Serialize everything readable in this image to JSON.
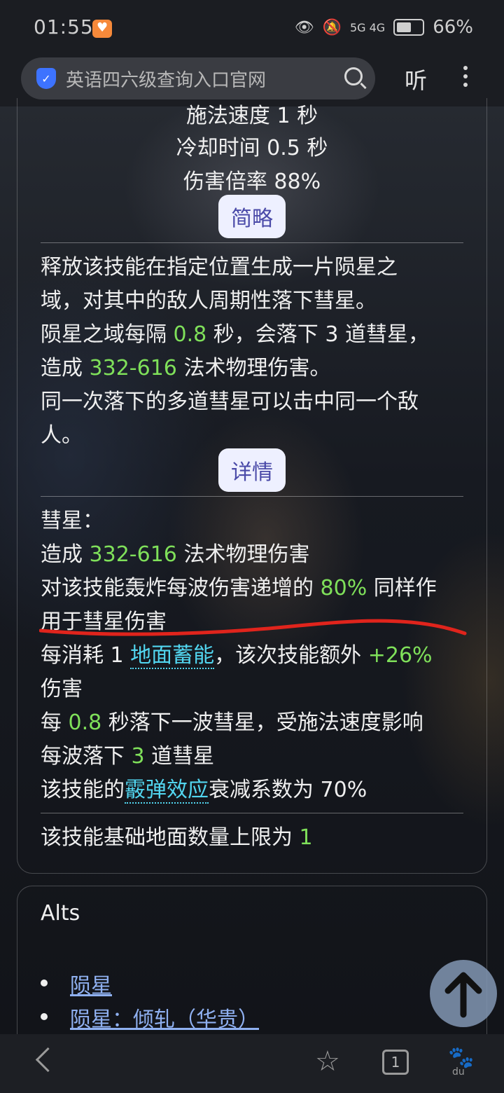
{
  "status_bar": {
    "time": "01:55",
    "network": "5G 4G",
    "battery": "66%"
  },
  "address_bar": {
    "query": "英语四六级查询入口官网",
    "listen_label": "听"
  },
  "skill": {
    "stats": [
      "施法速度 1 秒",
      "冷却时间  0.5 秒",
      "伤害倍率  88%"
    ],
    "summary_tab": "简略",
    "summary": {
      "line1": "释放该技能在指定位置生成一片陨星之",
      "line2": "域，对其中的敌人周期性落下彗星。",
      "line3_a": "陨星之域每隔 ",
      "line3_g": "0.8",
      "line3_b": " 秒，会落下 3 道彗星，",
      "line4_a": "造成 ",
      "line4_g": "332-616",
      "line4_b": " 法术物理伤害。",
      "line5": "同一次落下的多道彗星可以击中同一个敌",
      "line6": "人。"
    },
    "detail_tab": "详情",
    "details": {
      "d1": "彗星：",
      "d2_a": "造成 ",
      "d2_g": "332-616",
      "d2_b": " 法术物理伤害",
      "d3_a": "对该技能轰炸每波伤害递增的 ",
      "d3_g": "80%",
      "d3_b": " 同样作",
      "d4": "用于彗星伤害",
      "d5_a": "每消耗 1 ",
      "d5_t": "地面蓄能",
      "d5_b": "，该次技能额外 ",
      "d5_g": "+26%",
      "d6": "伤害",
      "d7_a": "每 ",
      "d7_g": "0.8",
      "d7_b": " 秒落下一波彗星，受施法速度影响",
      "d8_a": "每波落下 ",
      "d8_g": "3",
      "d8_b": " 道彗星",
      "d9_a": "该技能的",
      "d9_t": "霰弹效应",
      "d9_b": "衰减系数为 70%",
      "d10_a": "该技能基础地面数量上限为 ",
      "d10_g": "1"
    }
  },
  "alts": {
    "title": "Alts",
    "links": [
      "陨星",
      "陨星：倾轧（华贵）"
    ]
  },
  "colors": {
    "highlight_green": "#7fe05a",
    "term_cyan": "#52d6f0",
    "annotation_red": "#e0241c",
    "pill_bg": "#eef0ff"
  },
  "bottom_bar": {
    "tab_count": "1",
    "paw_label": "du"
  }
}
